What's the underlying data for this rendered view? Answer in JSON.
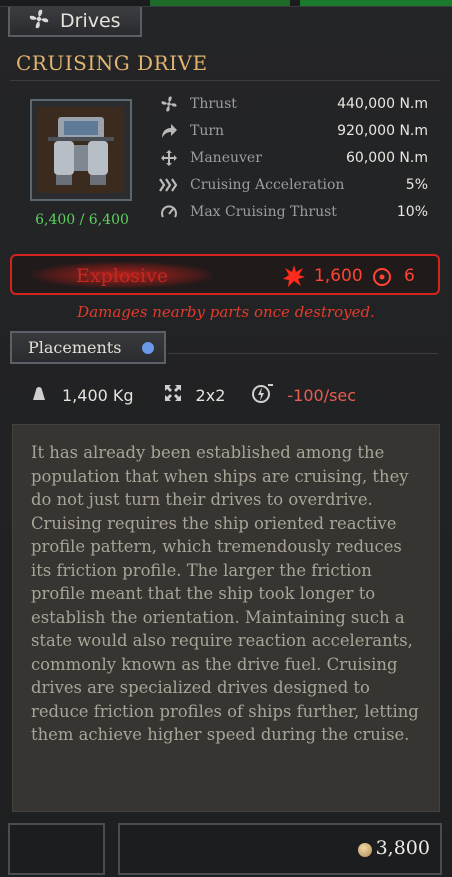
{
  "header": {
    "tab_label": "Drives"
  },
  "item": {
    "title": "CRUISING DRIVE",
    "health": "6,400 / 6,400",
    "stats": [
      {
        "icon": "fan-icon",
        "label": "Thrust",
        "value": "440,000 N.m"
      },
      {
        "icon": "turn-arrow-icon",
        "label": "Turn",
        "value": "920,000 N.m"
      },
      {
        "icon": "move-arrows-icon",
        "label": "Maneuver",
        "value": "60,000 N.m"
      },
      {
        "icon": "chevrons-icon",
        "label": "Cruising Acceleration",
        "value": "5%"
      },
      {
        "icon": "speedometer-icon",
        "label": "Max Cruising Thrust",
        "value": "10%"
      }
    ]
  },
  "explosive": {
    "title": "Explosive",
    "damage": "1,600",
    "radius": "6",
    "description": "Damages nearby parts once destroyed."
  },
  "placements": {
    "label": "Placements"
  },
  "specs": {
    "weight": "1,400 Kg",
    "size": "2x2",
    "power": "-100/sec"
  },
  "description": "It has already been established among the population that when ships are cruising, they do not just turn their drives to overdrive. Cruising requires the ship oriented reactive profile pattern, which tremendously reduces its friction profile. The larger the friction profile meant that the ship took longer to establish the orientation. Maintaining such a state would also require reaction accelerants, commonly known as the drive fuel. Cruising drives are specialized drives designed to reduce friction profiles of ships further, letting them achieve higher speed during the cruise.",
  "purchase": {
    "price": "3,800"
  },
  "colors": {
    "accent": "#e2b46f",
    "health": "#5ed05e",
    "danger": "#d3241f",
    "power": "#ea5d4f"
  }
}
